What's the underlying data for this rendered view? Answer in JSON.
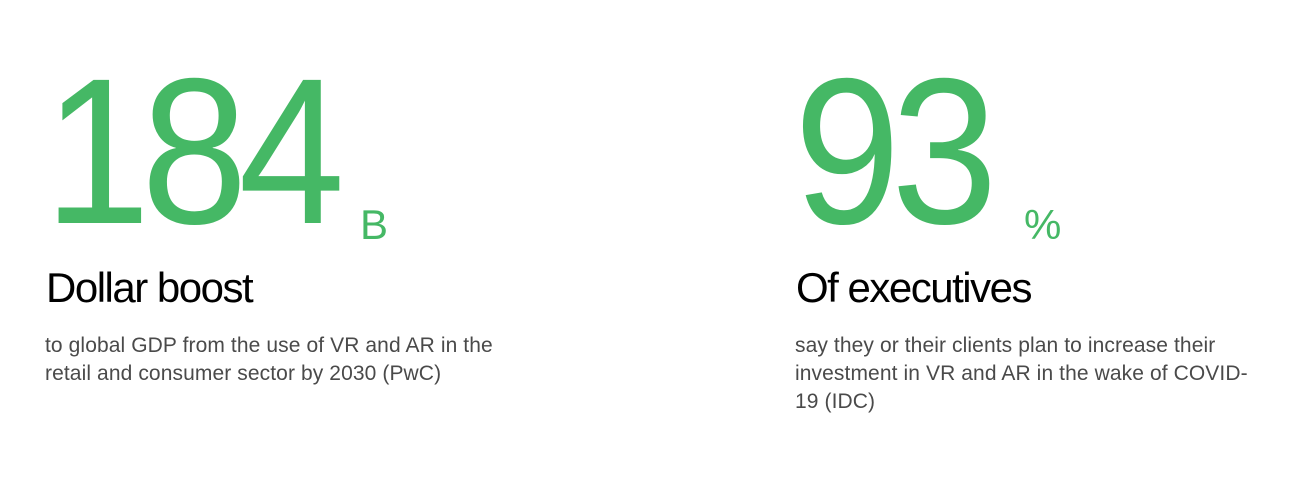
{
  "colors": {
    "accent": "#45b865",
    "heading": "#000000",
    "body_text": "#4a4a4a",
    "background": "#ffffff"
  },
  "stats": [
    {
      "number": "184",
      "unit": "B",
      "heading": "Dollar boost",
      "description": "to global GDP from the use of VR and AR in the retail and consumer sector by 2030 (PwC)"
    },
    {
      "number": "93",
      "unit": "%",
      "heading": "Of executives",
      "description": "say they or their clients plan to increase their investment in VR and AR in the wake of COVID-19 (IDC)"
    }
  ]
}
